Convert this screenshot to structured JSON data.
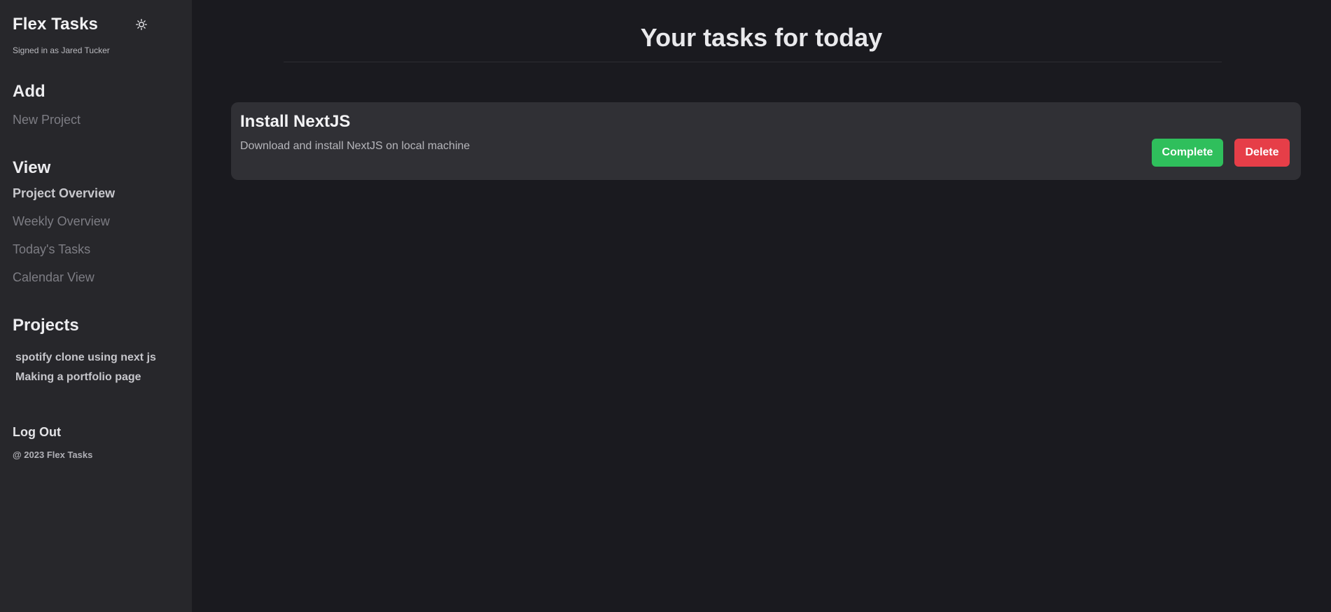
{
  "sidebar": {
    "brand": "Flex Tasks",
    "theme_icon": "sun-icon",
    "signed_in": "Signed in as Jared Tucker",
    "add": {
      "title": "Add",
      "items": [
        {
          "label": "New Project"
        }
      ]
    },
    "view": {
      "title": "View",
      "items": [
        {
          "label": "Project Overview",
          "active": true
        },
        {
          "label": "Weekly Overview",
          "active": false
        },
        {
          "label": "Today's Tasks",
          "active": false
        },
        {
          "label": "Calendar View",
          "active": false
        }
      ]
    },
    "projects": {
      "title": "Projects",
      "items": [
        {
          "label": "spotify clone using next js"
        },
        {
          "label": "Making a portfolio page"
        }
      ]
    },
    "logout": "Log Out",
    "copyright": "@ 2023 Flex Tasks"
  },
  "main": {
    "title": "Your tasks for today",
    "tasks": [
      {
        "title": "Install NextJS",
        "description": "Download and install NextJS on local machine",
        "complete_label": "Complete",
        "delete_label": "Delete"
      }
    ]
  },
  "colors": {
    "sidebar_bg": "#27272b",
    "main_bg": "#1a1a1f",
    "card_bg": "#303035",
    "complete": "#2fbf5c",
    "delete": "#e63e48"
  }
}
